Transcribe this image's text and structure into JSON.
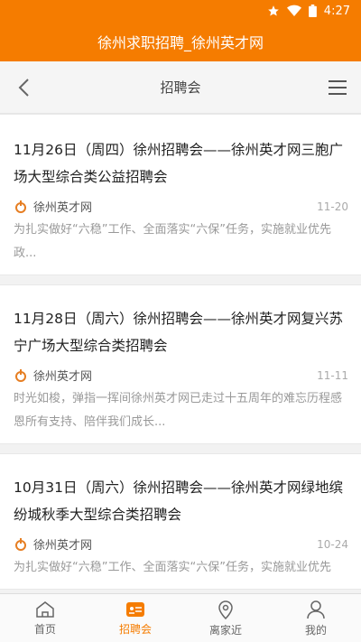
{
  "status_bar": {
    "time": "4:27"
  },
  "app": {
    "title": "徐州求职招聘_徐州英才网"
  },
  "nav": {
    "title": "招聘会"
  },
  "articles": [
    {
      "title": "11月26日（周四）徐州招聘会——徐州英才网三胞广场大型综合类公益招聘会",
      "source": "徐州英才网",
      "date": "11-20",
      "summary": "为扎实做好“六稳”工作、全面落实“六保”任务，实施就业优先政..."
    },
    {
      "title": "11月28日（周六）徐州招聘会——徐州英才网复兴苏宁广场大型综合类招聘会",
      "source": "徐州英才网",
      "date": "11-11",
      "summary": "时光如梭，弹指一挥间徐州英才网已走过十五周年的难忘历程感恩所有支持、陪伴我们成长..."
    },
    {
      "title": "10月31日（周六）徐州招聘会——徐州英才网绿地缤纷城秋季大型综合类招聘会",
      "source": "徐州英才网",
      "date": "10-24",
      "summary": "为扎实做好“六稳”工作、全面落实“六保”任务，实施就业优先"
    }
  ],
  "tabs": [
    {
      "label": "首页",
      "icon": "home-icon"
    },
    {
      "label": "招聘会",
      "icon": "job-fair-icon",
      "active": true
    },
    {
      "label": "离家近",
      "icon": "location-pin-icon"
    },
    {
      "label": "我的",
      "icon": "user-icon"
    }
  ],
  "colors": {
    "accent": "#f57c00"
  }
}
